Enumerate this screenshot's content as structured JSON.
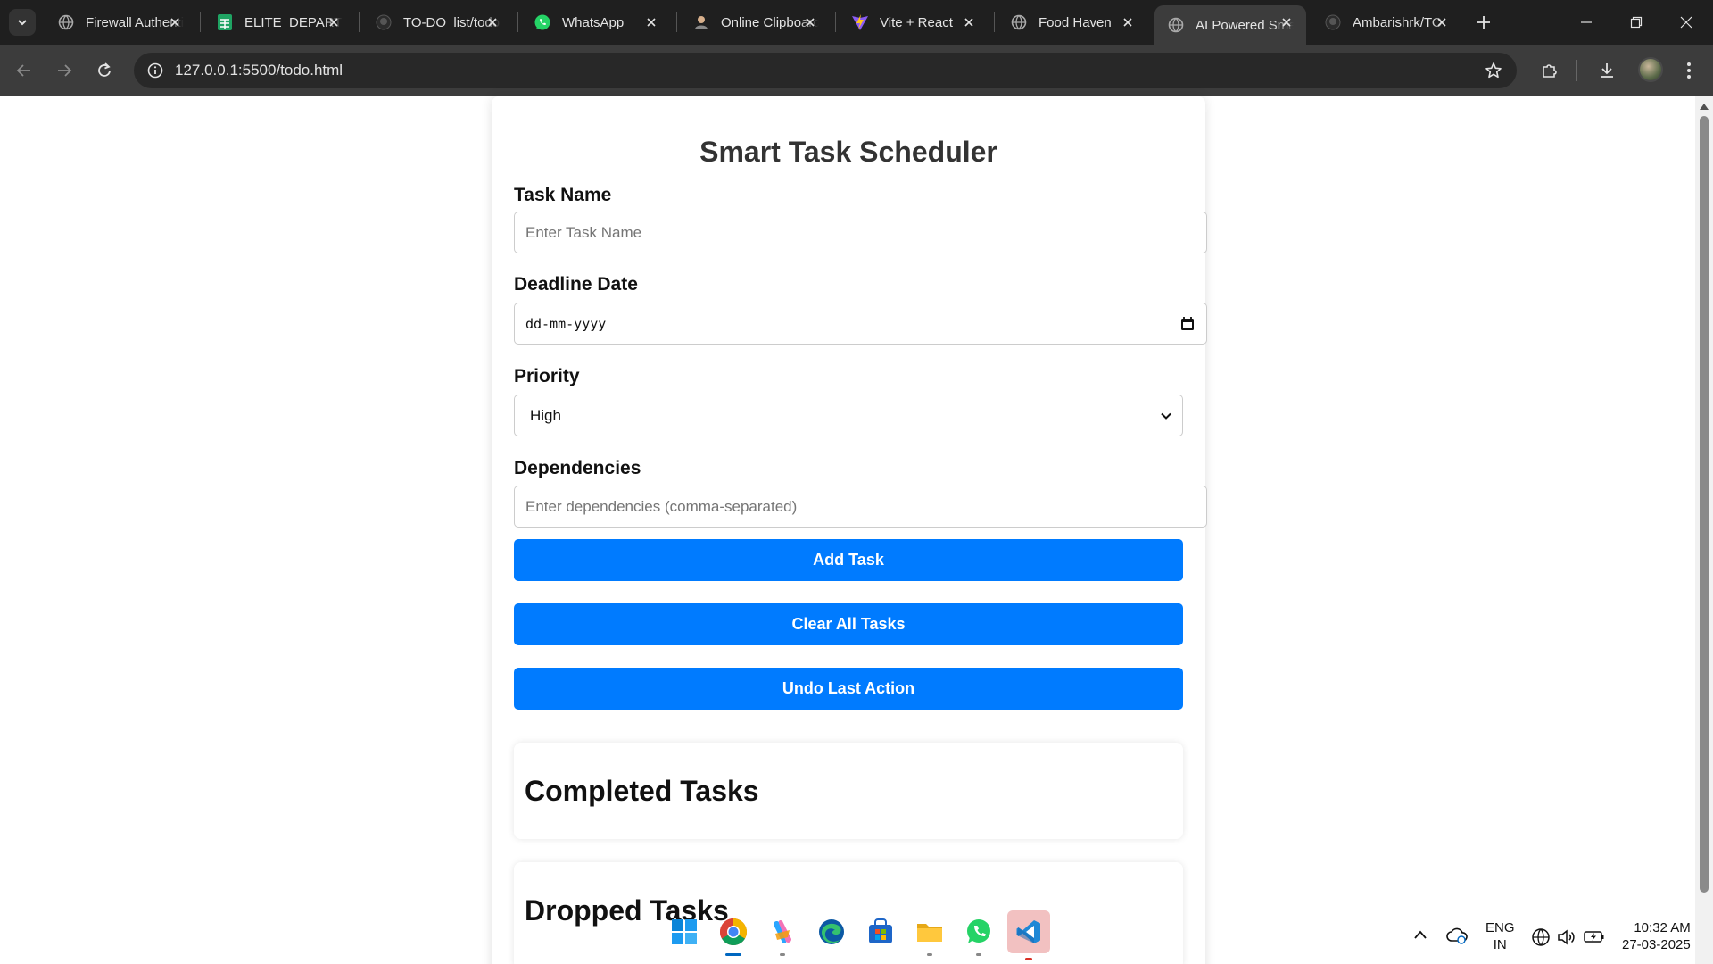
{
  "browser": {
    "tabs": [
      {
        "title": "Firewall Authentication",
        "icon": "globe-icon",
        "active": false
      },
      {
        "title": "ELITE_DEPARTMENT",
        "icon": "sheets-icon",
        "active": false
      },
      {
        "title": "TO-DO_list/todo",
        "icon": "github-icon",
        "active": false
      },
      {
        "title": "WhatsApp",
        "icon": "whatsapp-icon",
        "active": false
      },
      {
        "title": "Online Clipboard",
        "icon": "person-icon",
        "active": false
      },
      {
        "title": "Vite + React",
        "icon": "vite-icon",
        "active": false
      },
      {
        "title": "Food Haven",
        "icon": "globe-icon",
        "active": false
      },
      {
        "title": "AI Powered Smart",
        "icon": "globe-icon",
        "active": true
      },
      {
        "title": "Ambarishrk/TO",
        "icon": "github-icon",
        "active": false
      }
    ],
    "url": "127.0.0.1:5500/todo.html"
  },
  "app": {
    "title": "Smart Task Scheduler",
    "task_name_label": "Task Name",
    "task_name_placeholder": "Enter Task Name",
    "deadline_label": "Deadline Date",
    "deadline_value": "dd-mm-yyyy",
    "priority_label": "Priority",
    "priority_selected": "High",
    "dependencies_label": "Dependencies",
    "dependencies_placeholder": "Enter dependencies (comma-separated)",
    "add_button": "Add Task",
    "clear_button": "Clear All Tasks",
    "undo_button": "Undo Last Action",
    "completed_heading": "Completed Tasks",
    "dropped_heading": "Dropped Tasks"
  },
  "taskbar": {
    "apps": [
      "windows-start-icon",
      "chrome-icon",
      "copilot-icon",
      "edge-icon",
      "store-icon",
      "file-explorer-icon",
      "whatsapp-icon",
      "vscode-icon"
    ],
    "lang_primary": "ENG",
    "lang_secondary": "IN",
    "time": "10:32 AM",
    "date": "27-03-2025"
  },
  "colors": {
    "accent": "#007bff",
    "chrome_dark": "#1f1f1f",
    "toolbar": "#3c3c3c"
  }
}
